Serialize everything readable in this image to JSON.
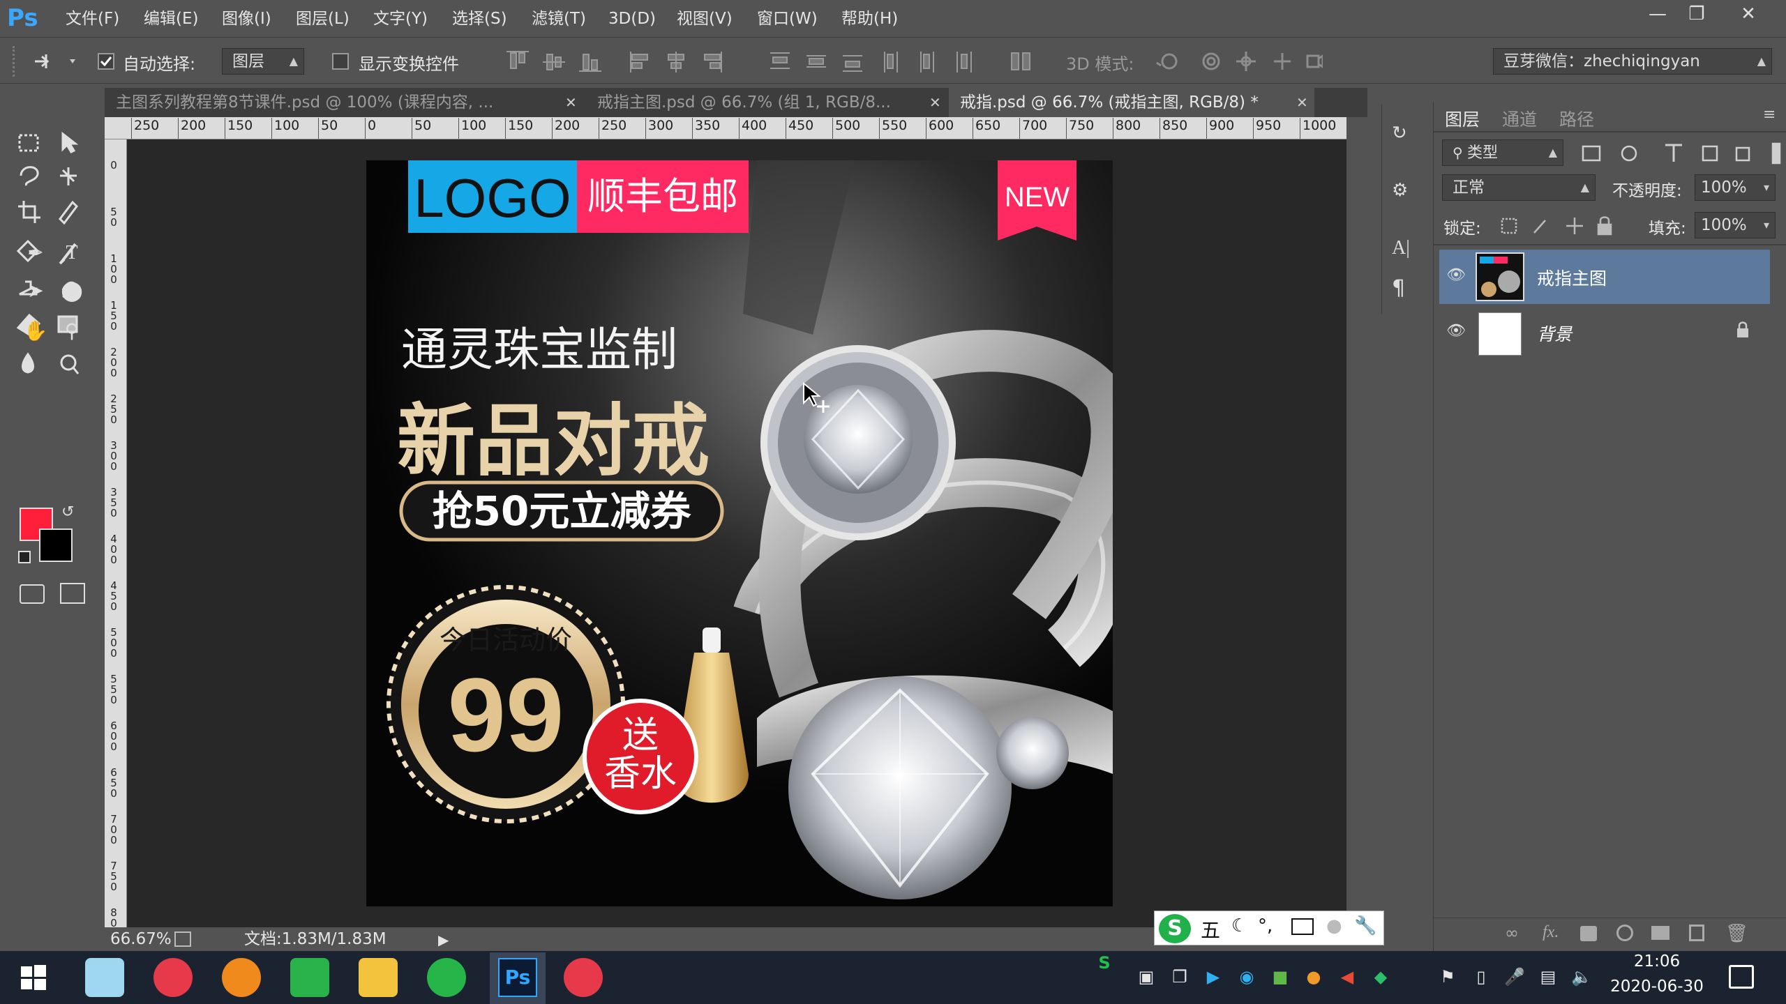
{
  "menubar": {
    "logo": "Ps",
    "items": [
      "文件(F)",
      "编辑(E)",
      "图像(I)",
      "图层(L)",
      "文字(Y)",
      "选择(S)",
      "滤镜(T)",
      "3D(D)",
      "视图(V)",
      "窗口(W)",
      "帮助(H)"
    ]
  },
  "options": {
    "auto_select_label": "自动选择:",
    "auto_select_checked": true,
    "target_value": "图层",
    "show_transform_label": "显示变换控件",
    "mode_3d_label": "3D 模式:",
    "workspace_value": "豆芽微信：zhechiqingyan"
  },
  "tabs": [
    {
      "label": "主图系列教程第8节课件.psd @ 100% (课程内容, ...",
      "active": false
    },
    {
      "label": "戒指主图.psd @ 66.7% (组 1, RGB/8...",
      "active": false
    },
    {
      "label": "戒指.psd @ 66.7% (戒指主图, RGB/8) *",
      "active": true
    }
  ],
  "ruler": {
    "h_labels": [
      "250",
      "200",
      "150",
      "100",
      "50",
      "0",
      "50",
      "100",
      "150",
      "200",
      "250",
      "300",
      "350",
      "400",
      "450",
      "500",
      "550",
      "600",
      "650",
      "700",
      "750",
      "800",
      "850",
      "900",
      "950",
      "1000"
    ],
    "v_labels": [
      "0",
      "50",
      "100",
      "150",
      "200",
      "250",
      "300",
      "350",
      "400",
      "450",
      "500",
      "550",
      "600",
      "650",
      "700",
      "750",
      "800"
    ]
  },
  "poster": {
    "logo": "LOGO",
    "free_shipping": "顺丰包邮",
    "new_badge": "NEW",
    "line1": "通灵珠宝监制",
    "headline": "新品对戒",
    "coupon": "抢50元立减券",
    "today_price_label": "今日活动价",
    "price": "99",
    "gift_line1": "送",
    "gift_line2": "香水"
  },
  "layers_panel": {
    "tabs": [
      "图层",
      "通道",
      "路径"
    ],
    "filter_label": "类型",
    "blend_mode": "正常",
    "opacity_label": "不透明度:",
    "opacity_value": "100%",
    "lock_label": "锁定:",
    "fill_label": "填充:",
    "fill_value": "100%",
    "layers": [
      {
        "name": "戒指主图",
        "selected": true
      },
      {
        "name": "背景",
        "selected": false,
        "locked": true
      }
    ]
  },
  "status": {
    "zoom": "66.67%",
    "doc_size": "文档:1.83M/1.83M"
  },
  "ime": {
    "mode": "五"
  },
  "taskbar": {
    "time": "21:06",
    "date": "2020-06-30"
  },
  "colors": {
    "foreground": "#ff1f3a",
    "background": "#000000",
    "logo_blue": "#16a8e6",
    "pink": "#ff2a62",
    "gold": "#d9b98a"
  }
}
